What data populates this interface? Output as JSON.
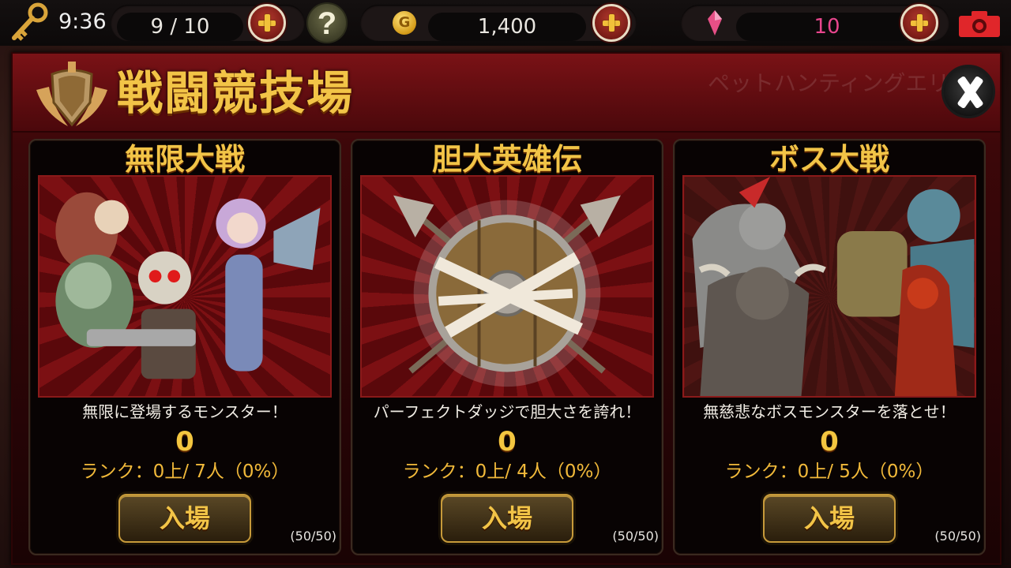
{
  "topbar": {
    "clock": "9:36",
    "energy": "9 / 10",
    "gold": "1,400",
    "coin_glyph": "G",
    "gems": "10",
    "help_glyph": "?"
  },
  "panel": {
    "title": "戦闘競技場",
    "header_ghost_text": "ペットハンティングエリ"
  },
  "cards": [
    {
      "title": "無限大戦",
      "description": "無限に登場するモンスター！",
      "score": "0",
      "rank": "ランク：0上/ 7人（0%）",
      "button": "入場",
      "count": "(50/50)",
      "art": "heroes-group"
    },
    {
      "title": "胆大英雄伝",
      "description": "パーフェクトダッジで胆大さを誇れ！",
      "score": "0",
      "rank": "ランク：0上/ 4人（0%）",
      "button": "入場",
      "count": "(50/50)",
      "art": "shield-spears"
    },
    {
      "title": "ボス大戦",
      "description": "無慈悲なボスモンスターを落とせ！",
      "score": "0",
      "rank": "ランク：0上/ 5人（0%）",
      "button": "入場",
      "count": "(50/50)",
      "art": "boss-group"
    }
  ],
  "colors": {
    "accent_gold": "#f2c447",
    "gem_pink": "#e8468d",
    "panel_red": "#5e0d10"
  },
  "icons": [
    "key-icon",
    "plus-icon",
    "help-icon",
    "gold-coin-icon",
    "gem-icon",
    "camera-icon",
    "arena-emblem-icon",
    "close-icon"
  ]
}
